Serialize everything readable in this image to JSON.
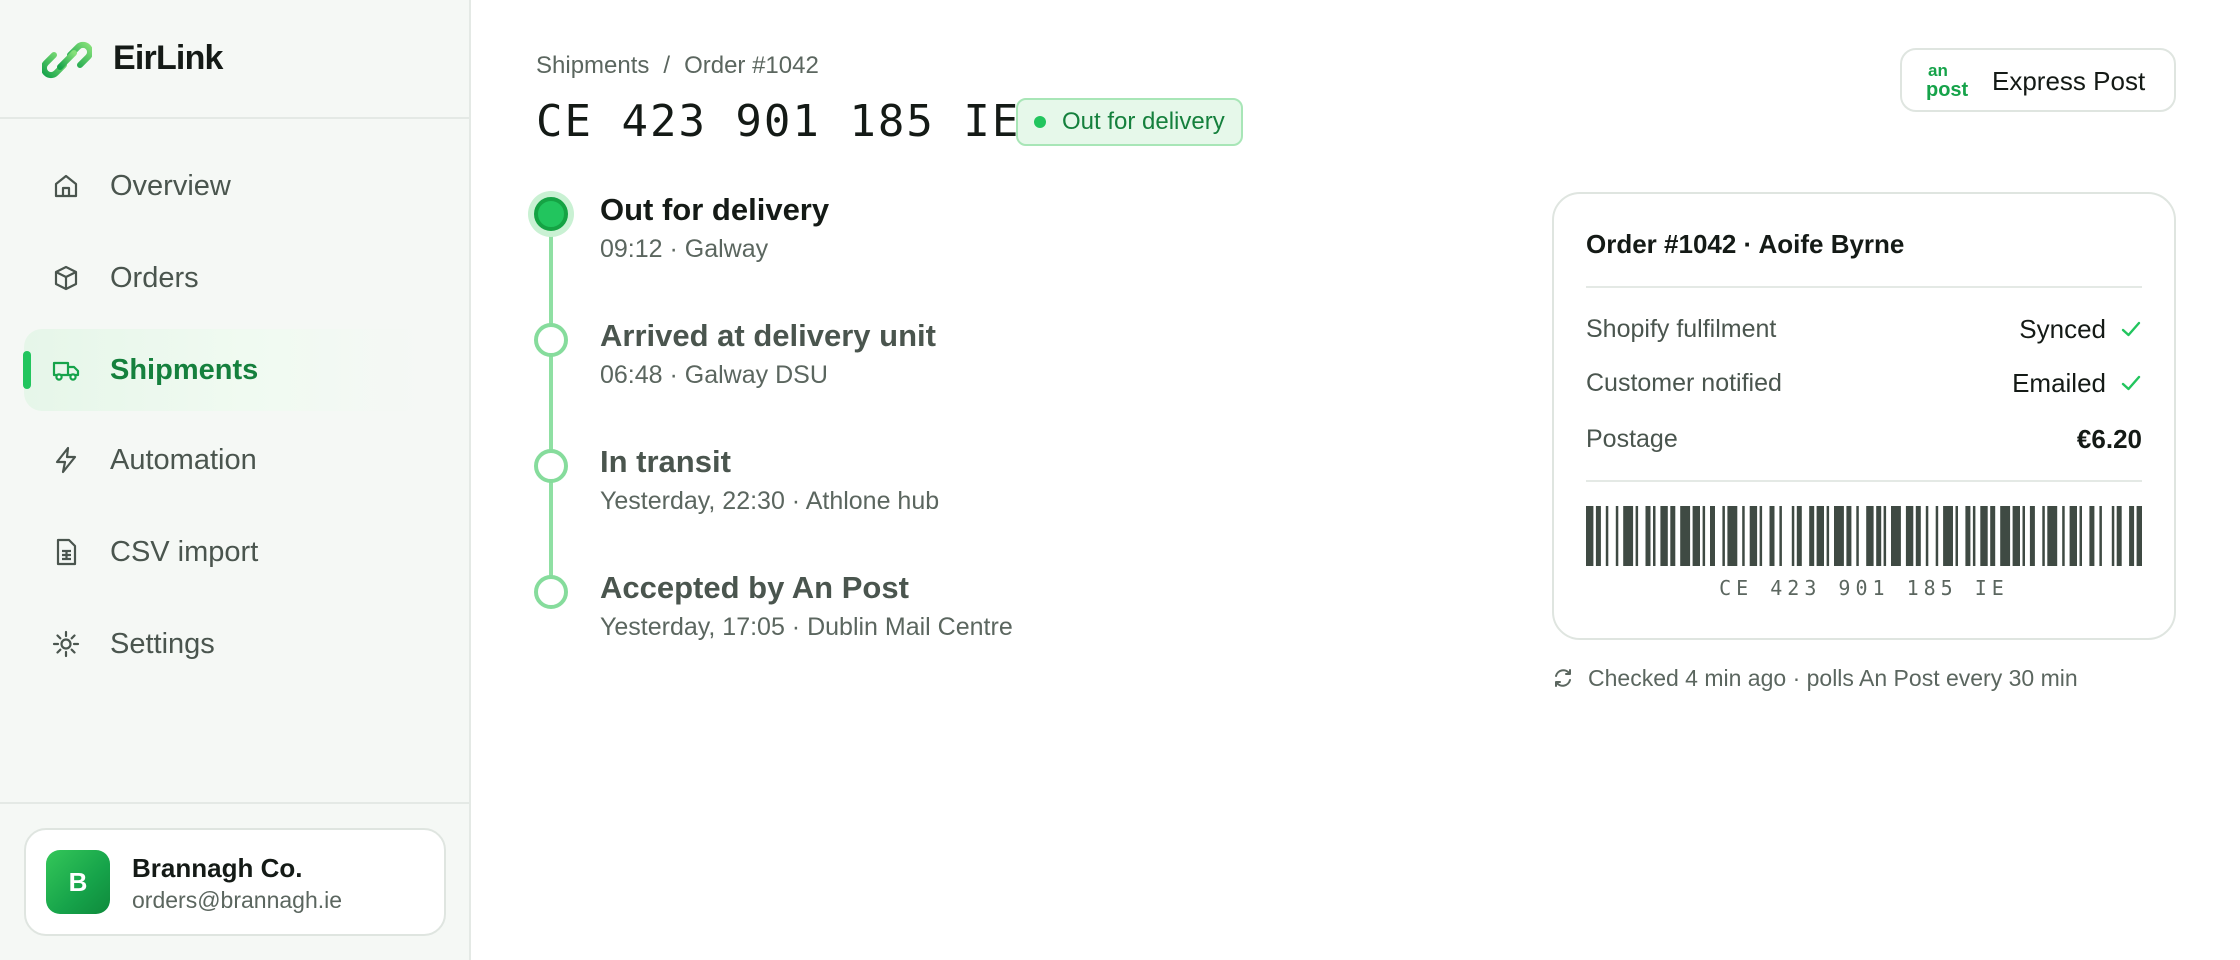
{
  "app": {
    "name": "EirLink"
  },
  "sidebar": {
    "items": [
      {
        "label": "Overview",
        "icon": "home-icon",
        "active": false
      },
      {
        "label": "Orders",
        "icon": "box-icon",
        "active": false
      },
      {
        "label": "Shipments",
        "icon": "truck-icon",
        "active": true
      },
      {
        "label": "Automation",
        "icon": "lightning-icon",
        "active": false
      },
      {
        "label": "CSV import",
        "icon": "spreadsheet-file-icon",
        "active": false
      },
      {
        "label": "Settings",
        "icon": "gear-icon",
        "active": false
      }
    ],
    "account": {
      "avatar_initial": "B",
      "name": "Brannagh Co.",
      "email": "orders@brannagh.ie"
    }
  },
  "header": {
    "breadcrumb": [
      "Shipments",
      "/",
      "Order #1042"
    ],
    "tracking_number": "CE 423 901 185 IE",
    "status": "Out for delivery",
    "carrier": {
      "logo_text_top": "an",
      "logo_text_bottom": "post",
      "label": "Express Post"
    }
  },
  "timeline": [
    {
      "title": "Out for delivery",
      "detail": "09:12 · Galway",
      "current": true
    },
    {
      "title": "Arrived at delivery unit",
      "detail": "06:48 · Galway DSU",
      "current": false
    },
    {
      "title": "In transit",
      "detail": "Yesterday, 22:30 · Athlone hub",
      "current": false
    },
    {
      "title": "Accepted by An Post",
      "detail": "Yesterday, 17:05 · Dublin Mail Centre",
      "current": false
    }
  ],
  "order_card": {
    "title": "Order #1042 · Aoife Byrne",
    "rows": [
      {
        "label": "Shopify fulfilment",
        "value": "Synced",
        "check": true
      },
      {
        "label": "Customer notified",
        "value": "Emailed",
        "check": true
      },
      {
        "label": "Postage",
        "value": "€6.20",
        "check": false
      }
    ],
    "barcode_text": "CE 423 901 185 IE"
  },
  "poll_note": "Checked 4 min ago · polls An Post every 30 min",
  "colors": {
    "accent": "#22c55e",
    "accent_dark": "#15803d",
    "text": "#141a16",
    "muted": "#5b665f"
  }
}
